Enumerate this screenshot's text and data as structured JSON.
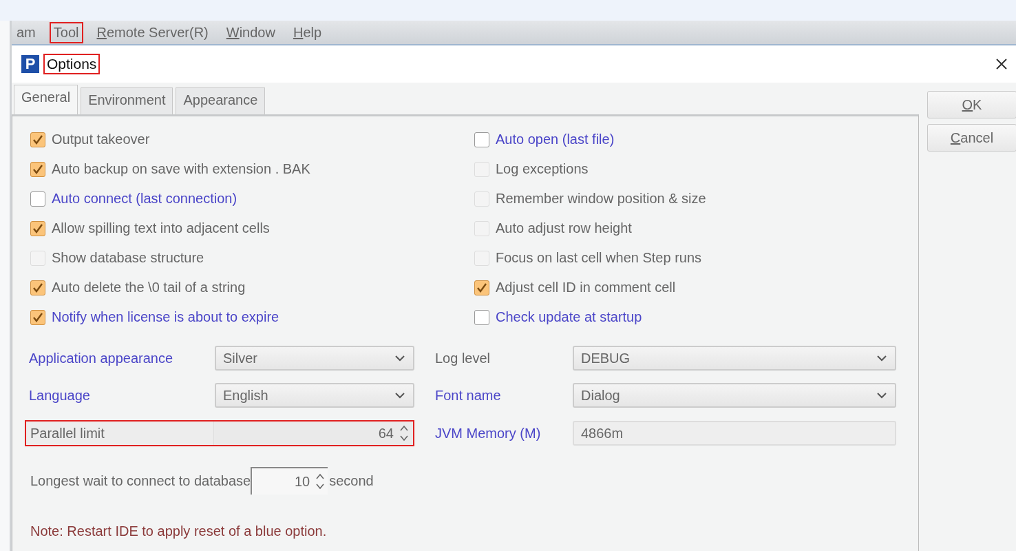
{
  "menu_bar": {
    "items": [
      {
        "label": "am",
        "underline_first": false,
        "highlighted": false
      },
      {
        "label": "Tool",
        "underline_first": false,
        "highlighted": true
      },
      {
        "label": "Remote Server(R)",
        "underline_first": true,
        "highlighted": false
      },
      {
        "label": "Window",
        "underline_first": true,
        "highlighted": false
      },
      {
        "label": "Help",
        "underline_first": true,
        "highlighted": false
      }
    ]
  },
  "dialog": {
    "icon_letter": "P",
    "title": "Options",
    "title_highlighted": true,
    "tabs": [
      {
        "label": "General",
        "selected": true
      },
      {
        "label": "Environment",
        "selected": false
      },
      {
        "label": "Appearance",
        "selected": false
      }
    ],
    "buttons": [
      {
        "label": "OK",
        "underline_first": true
      },
      {
        "label": "Cancel",
        "underline_first": true
      }
    ],
    "checkbox_columns": [
      [
        {
          "label": "Output takeover",
          "checked": true,
          "disabled": false,
          "needs_restart": false
        },
        {
          "label": "Auto backup on save with extension . BAK",
          "checked": true,
          "disabled": false,
          "needs_restart": false
        },
        {
          "label": "Auto connect (last connection)",
          "checked": false,
          "disabled": false,
          "needs_restart": true
        },
        {
          "label": "Allow spilling text into adjacent cells",
          "checked": true,
          "disabled": false,
          "needs_restart": false
        },
        {
          "label": "Show database structure",
          "checked": false,
          "disabled": true,
          "needs_restart": false
        },
        {
          "label": "Auto delete the \\0 tail of a string",
          "checked": true,
          "disabled": false,
          "needs_restart": false
        },
        {
          "label": "Notify when license is about to expire",
          "checked": true,
          "disabled": false,
          "needs_restart": true
        }
      ],
      [
        {
          "label": "Auto open (last file)",
          "checked": false,
          "disabled": false,
          "needs_restart": true
        },
        {
          "label": "Log exceptions",
          "checked": false,
          "disabled": true,
          "needs_restart": false
        },
        {
          "label": "Remember window position & size",
          "checked": false,
          "disabled": true,
          "needs_restart": false
        },
        {
          "label": "Auto adjust row height",
          "checked": false,
          "disabled": true,
          "needs_restart": false
        },
        {
          "label": "Focus on last cell when Step runs",
          "checked": false,
          "disabled": true,
          "needs_restart": false
        },
        {
          "label": "Adjust cell ID in comment cell",
          "checked": true,
          "disabled": false,
          "needs_restart": false
        },
        {
          "label": "Check update at startup",
          "checked": false,
          "disabled": false,
          "needs_restart": true
        }
      ]
    ],
    "form_rows": [
      [
        {
          "kind": "dropdown",
          "label": "Application appearance",
          "value": "Silver",
          "needs_restart": true
        },
        {
          "kind": "dropdown",
          "label": "Log level",
          "value": "DEBUG",
          "needs_restart": false
        }
      ],
      [
        {
          "kind": "dropdown",
          "label": "Language",
          "value": "English",
          "needs_restart": true
        },
        {
          "kind": "dropdown",
          "label": "Font name",
          "value": "Dialog",
          "needs_restart": true
        }
      ],
      [
        {
          "kind": "spinner",
          "label": "Parallel limit",
          "value": "64",
          "needs_restart": false,
          "highlighted": true
        },
        {
          "kind": "text",
          "label": "JVM  Memory (M)",
          "value": "4866m",
          "needs_restart": true
        }
      ]
    ],
    "wait_row": {
      "label": "Longest wait to connect to database",
      "value": "10",
      "unit": "second"
    },
    "note": "Note: Restart IDE to apply reset of a blue option."
  }
}
